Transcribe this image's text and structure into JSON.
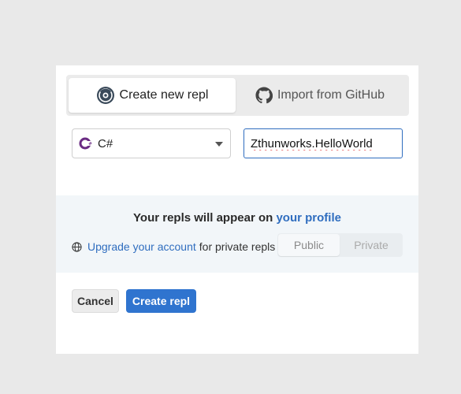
{
  "tabs": [
    {
      "label": "Create new repl",
      "icon": "replit-icon",
      "active": true
    },
    {
      "label": "Import from GitHub",
      "icon": "github-icon",
      "active": false
    }
  ],
  "language": {
    "selected": "C#",
    "icon": "csharp-icon"
  },
  "repl_name": {
    "value": "Zthunworks.HelloWorld"
  },
  "profile": {
    "heading_prefix": "Your repls will appear on",
    "heading_link": "your profile",
    "upgrade_link": "Upgrade your account",
    "upgrade_suffix": "for private repls"
  },
  "privacy": {
    "options": [
      "Public",
      "Private"
    ],
    "selected": "Public"
  },
  "buttons": {
    "cancel": "Cancel",
    "create": "Create repl"
  },
  "colors": {
    "accent": "#2f74cf",
    "link": "#2f6dbf",
    "csharp": "#6a2b83"
  }
}
